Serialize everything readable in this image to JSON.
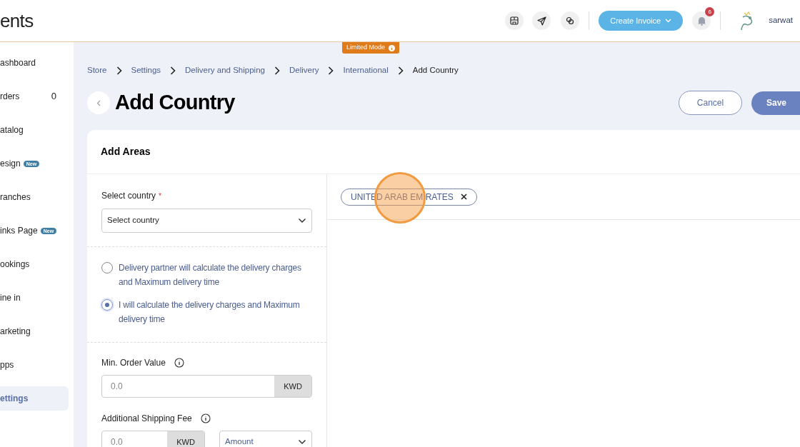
{
  "header": {
    "logo_text": "ents",
    "create_button": "Create Invoice",
    "notification_count": "6",
    "user_name": "sarwat"
  },
  "limited_mode": "Limited Mode",
  "sidebar": {
    "items": [
      {
        "label": "ashboard",
        "selected": false
      },
      {
        "label": "rders",
        "count": "0",
        "selected": false
      },
      {
        "label": "atalog",
        "selected": false
      },
      {
        "label": "esign",
        "badge": "New",
        "selected": false
      },
      {
        "label": "ranches",
        "selected": false
      },
      {
        "label": "inks Page",
        "badge": "New",
        "selected": false
      },
      {
        "label": "ookings",
        "selected": false
      },
      {
        "label": "ine in",
        "selected": false
      },
      {
        "label": "arketing",
        "selected": false
      },
      {
        "label": "pps",
        "selected": false
      },
      {
        "label": "ettings",
        "selected": true
      }
    ]
  },
  "breadcrumb": [
    "Store",
    "Settings",
    "Delivery and Shipping",
    "Delivery",
    "International",
    "Add Country"
  ],
  "page_title": "Add Country",
  "actions": {
    "cancel": "Cancel",
    "save": "Save"
  },
  "card": {
    "title": "Add Areas",
    "country_field": {
      "label": "Select country",
      "required_mark": "*",
      "value": "Select country"
    },
    "options": [
      {
        "label": "Delivery partner will calculate the delivery charges and Maximum delivery time",
        "selected": false
      },
      {
        "label": "I will calculate the delivery charges and Maximum delivery time",
        "selected": true
      }
    ],
    "min_order": {
      "label": "Min. Order Value",
      "placeholder": "0.0",
      "unit": "KWD"
    },
    "shipping_fee": {
      "label": "Additional Shipping Fee",
      "placeholder": "0.0",
      "unit": "KWD",
      "type": "Amount"
    },
    "chips": [
      {
        "label": "UNITED ARAB EMIRATES"
      }
    ]
  }
}
